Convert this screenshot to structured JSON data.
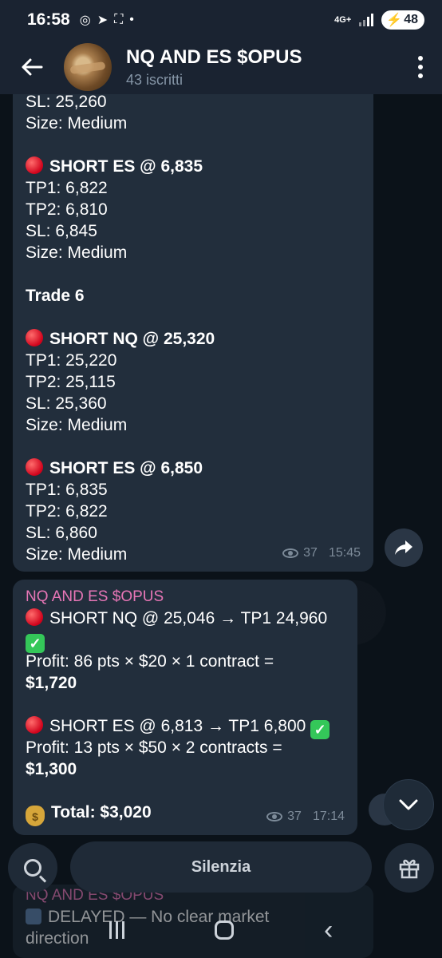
{
  "status_bar": {
    "time": "16:58",
    "network": "4G+",
    "battery": "48"
  },
  "header": {
    "title": "NQ AND ES $OPUS",
    "subtitle": "43 iscritti"
  },
  "message1": {
    "lines": [
      "SL: 25,260",
      "Size: Medium",
      "",
      "SHORT ES @ 6,835",
      "TP1: 6,822",
      "TP2: 6,810",
      "SL: 6,845",
      "Size: Medium",
      "",
      "Trade 6",
      "",
      "SHORT NQ @ 25,320",
      "TP1: 25,220",
      "TP2: 25,115",
      "SL: 25,360",
      "Size: Medium",
      "",
      "SHORT ES @ 6,850",
      "TP1: 6,835",
      "TP2: 6,822",
      "SL: 6,860",
      "Size: Medium"
    ],
    "views": "37",
    "time": "15:45"
  },
  "message2": {
    "sender": "NQ AND ES $OPUS",
    "trade1": "SHORT NQ @ 25,046 → TP1 24,960",
    "profit1_label": "Profit:  86 pts × $20 × 1 contract =",
    "profit1_value": "$1,720",
    "trade2": "SHORT ES @ 6,813 → TP1 6,800",
    "profit2_label": "Profit:  13 pts × $50 × 2 contracts =",
    "profit2_value": "$1,300",
    "total": "Total:  $3,020",
    "views": "37",
    "time": "17:14"
  },
  "bottom_bar": {
    "mute_label": "Silenzia"
  },
  "message3": {
    "sender": "NQ AND ES $OPUS",
    "line1": "DELAYED — No clear market",
    "line2": "direction"
  }
}
